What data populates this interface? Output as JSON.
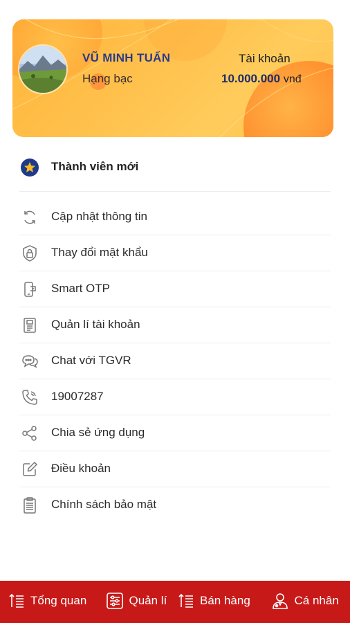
{
  "profile": {
    "name": "VŨ MINH TUẤN",
    "rank": "Hạng bạc",
    "account_label": "Tài khoản",
    "balance": "10.000.000",
    "currency": "vnđ"
  },
  "membership": {
    "label": "Thành viên mới",
    "icon": "star-badge-icon"
  },
  "menu": [
    {
      "label": "Cập nhật thông tin",
      "icon": "refresh-icon"
    },
    {
      "label": "Thay đổi mật khẩu",
      "icon": "lock-shield-icon"
    },
    {
      "label": "Smart OTP",
      "icon": "phone-otp-icon"
    },
    {
      "label": "Quản lí tài khoản",
      "icon": "account-card-icon"
    },
    {
      "label": "Chat với TGVR",
      "icon": "chat-icon"
    },
    {
      "label": "19007287",
      "icon": "phone-call-icon"
    },
    {
      "label": "Chia sẻ ứng dụng",
      "icon": "share-icon"
    },
    {
      "label": "Điều khoản",
      "icon": "edit-icon"
    },
    {
      "label": "Chính sách bảo mật",
      "icon": "clipboard-icon"
    }
  ],
  "tabs": [
    {
      "label": "Tổng quan",
      "icon": "sort-list-icon"
    },
    {
      "label": "Quản lí",
      "icon": "sliders-icon"
    },
    {
      "label": "Bán hàng",
      "icon": "sort-list-icon"
    },
    {
      "label": "Cá nhân",
      "icon": "user-icon"
    }
  ],
  "colors": {
    "card": "#ffbf48",
    "accent_blue": "#2a3a8a",
    "tabbar": "#c81919"
  }
}
